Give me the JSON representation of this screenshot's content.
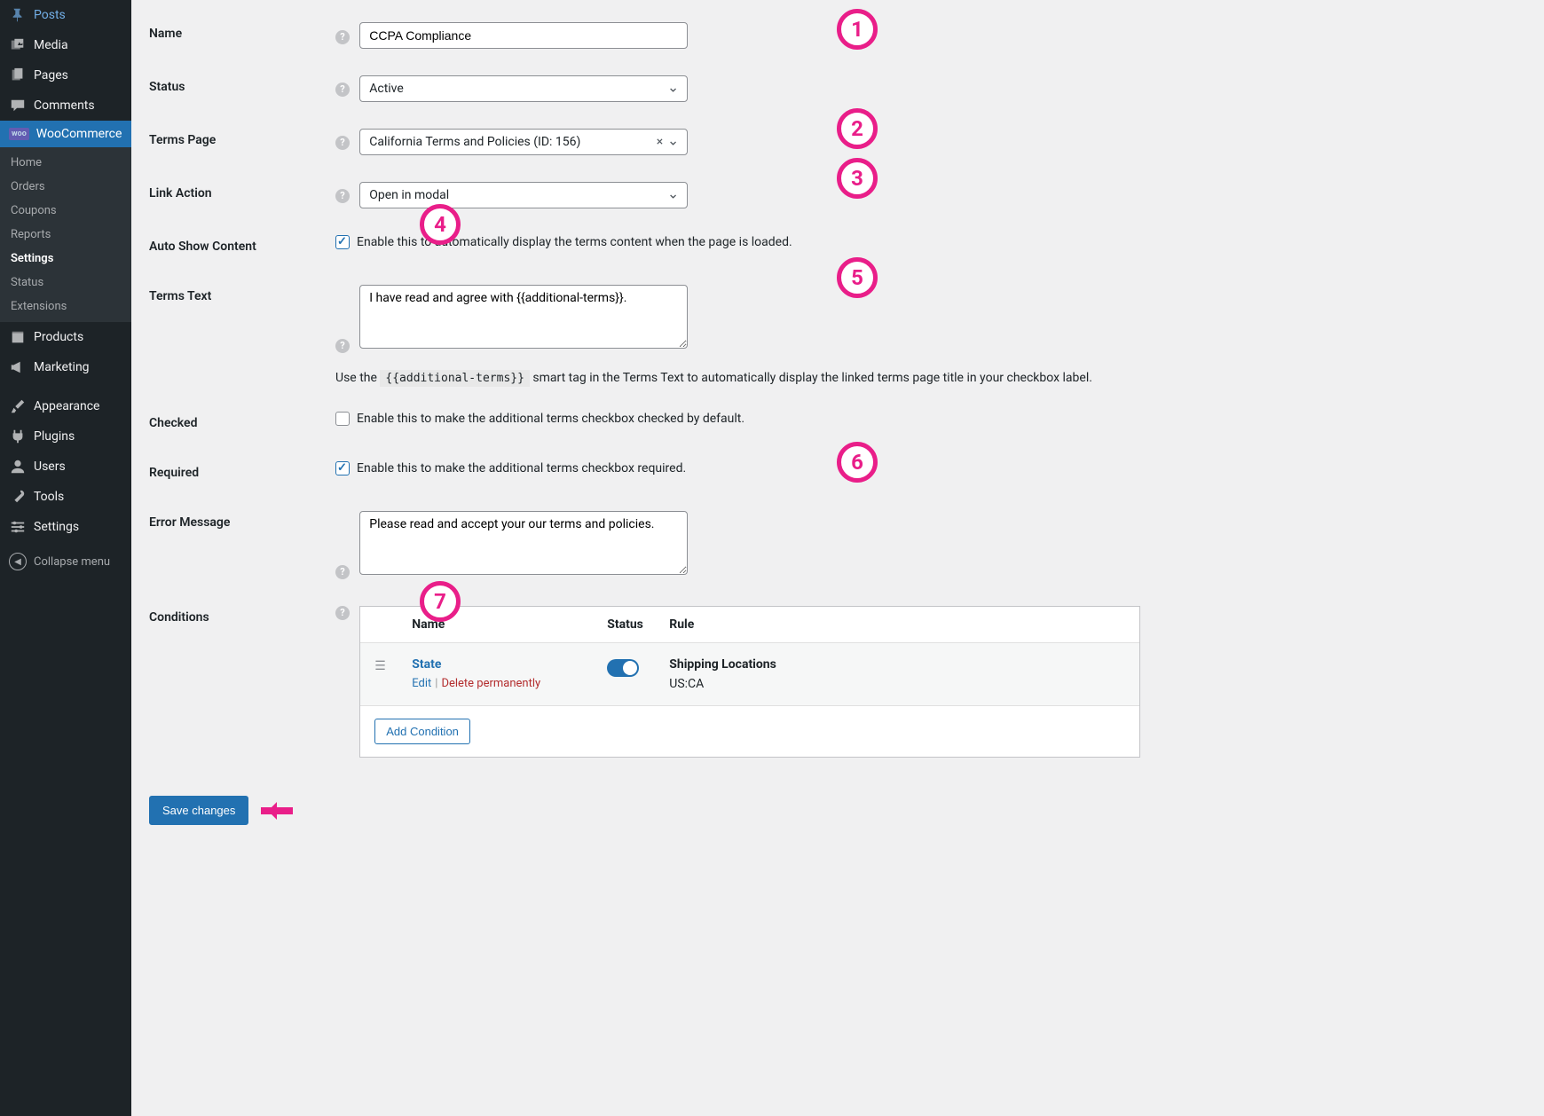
{
  "sidebar": {
    "items": [
      {
        "label": "Posts",
        "icon": "pin"
      },
      {
        "label": "Media",
        "icon": "media"
      },
      {
        "label": "Pages",
        "icon": "pages"
      },
      {
        "label": "Comments",
        "icon": "comment"
      },
      {
        "label": "WooCommerce",
        "icon": "woo",
        "active": true
      },
      {
        "label": "Products",
        "icon": "box"
      },
      {
        "label": "Marketing",
        "icon": "megaphone"
      },
      {
        "label": "Appearance",
        "icon": "brush"
      },
      {
        "label": "Plugins",
        "icon": "plug"
      },
      {
        "label": "Users",
        "icon": "user"
      },
      {
        "label": "Tools",
        "icon": "wrench"
      },
      {
        "label": "Settings",
        "icon": "sliders"
      }
    ],
    "woo_sub": [
      {
        "label": "Home"
      },
      {
        "label": "Orders"
      },
      {
        "label": "Coupons"
      },
      {
        "label": "Reports"
      },
      {
        "label": "Settings",
        "active": true
      },
      {
        "label": "Status"
      },
      {
        "label": "Extensions"
      }
    ],
    "collapse_label": "Collapse menu"
  },
  "form": {
    "name_label": "Name",
    "name_value": "CCPA Compliance",
    "status_label": "Status",
    "status_value": "Active",
    "terms_page_label": "Terms Page",
    "terms_page_value": "California Terms and Policies (ID: 156)",
    "link_action_label": "Link Action",
    "link_action_value": "Open in modal",
    "auto_show_label": "Auto Show Content",
    "auto_show_checkbox": "Enable this to automatically display the terms content when the page is loaded.",
    "terms_text_label": "Terms Text",
    "terms_text_value": "I have read and agree with {{additional-terms}}.",
    "terms_text_hint_pre": "Use the ",
    "terms_text_hint_code": "{{additional-terms}}",
    "terms_text_hint_post": " smart tag in the Terms Text to automatically display the linked terms page title in your checkbox label.",
    "checked_label": "Checked",
    "checked_checkbox": "Enable this to make the additional terms checkbox checked by default.",
    "required_label": "Required",
    "required_checkbox": "Enable this to make the additional terms checkbox required.",
    "error_msg_label": "Error Message",
    "error_msg_value": "Please read and accept your our terms and policies.",
    "conditions_label": "Conditions"
  },
  "conditions": {
    "header_name": "Name",
    "header_status": "Status",
    "header_rule": "Rule",
    "rows": [
      {
        "name": "State",
        "edit": "Edit",
        "delete": "Delete permanently",
        "rule_title": "Shipping Locations",
        "rule_value": "US:CA"
      }
    ],
    "add_button": "Add Condition"
  },
  "save_button": "Save changes",
  "callouts": {
    "c1": "1",
    "c2": "2",
    "c3": "3",
    "c4": "4",
    "c5": "5",
    "c6": "6",
    "c7": "7"
  }
}
